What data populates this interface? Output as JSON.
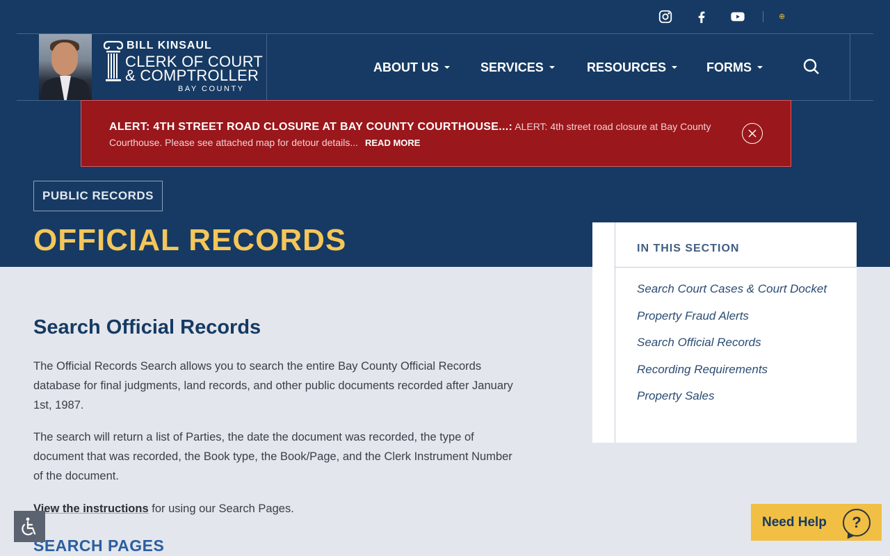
{
  "header": {
    "social_icons": [
      "instagram-icon",
      "facebook-icon",
      "youtube-icon"
    ],
    "language_icon": "globe-icon",
    "brand": {
      "name": "BILL KINSAUL",
      "line1": "CLERK OF COURT",
      "line2": "& COMPTROLLER",
      "county": "BAY COUNTY"
    },
    "nav": [
      {
        "label": "ABOUT US"
      },
      {
        "label": "SERVICES"
      },
      {
        "label": "RESOURCES"
      },
      {
        "label": "FORMS"
      }
    ],
    "search_icon": "search-icon"
  },
  "alert": {
    "title": "ALERT: 4TH STREET ROAD CLOSURE AT BAY COUNTY COURTHOUSE...:",
    "body": " ALERT: 4th street road closure at Bay County Courthouse. Please see attached map for detour details...",
    "read_more": "READ MORE",
    "close_icon": "close-icon"
  },
  "hero": {
    "badge": "PUBLIC RECORDS",
    "title": "OFFICIAL RECORDS"
  },
  "sidebar": {
    "heading": "IN THIS SECTION",
    "links": [
      {
        "label": "Search Court Cases & Court Docket"
      },
      {
        "label": "Property Fraud Alerts"
      },
      {
        "label": "Search Official Records"
      },
      {
        "label": "Recording Requirements"
      },
      {
        "label": "Property Sales"
      }
    ]
  },
  "main": {
    "heading": "Search Official Records",
    "para1": "The Official Records Search allows you to search the entire Bay County Official Records database for final judgments, land records, and other public documents recorded after January 1st, 1987.",
    "para2": "The search will return a list of Parties, the date the document was recorded, the type of document that was recorded, the Book type, the Book/Page, and the Clerk Instrument Number of the document.",
    "instructions_link": "View the instructions",
    "instructions_rest": " for using our Search Pages.",
    "subheading": "SEARCH PAGES"
  },
  "widgets": {
    "accessibility_icon": "accessibility-icon",
    "help_label": "Need Help",
    "help_icon": "question-icon",
    "help_icon_glyph": "?"
  },
  "colors": {
    "navy": "#163a63",
    "alert_red": "#9a171b",
    "gold": "#f5c65a",
    "help_yellow": "#f0bf43",
    "page_bg": "#e3e6ec"
  }
}
